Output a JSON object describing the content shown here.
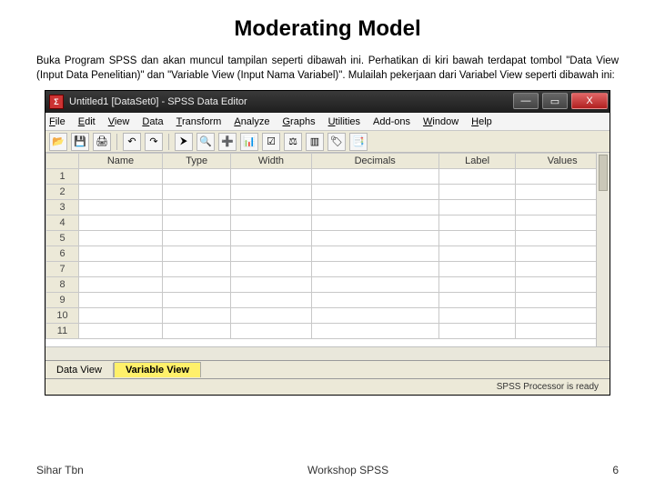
{
  "slide": {
    "title": "Moderating Model",
    "body": "Buka Program SPSS dan akan muncul tampilan seperti dibawah ini. Perhatikan di kiri bawah terdapat tombol \"Data View (Input Data Penelitian)\" dan \"Variable View (Input Nama Variabel)\". Mulailah pekerjaan dari Variabel View seperti dibawah ini:"
  },
  "window": {
    "title": "Untitled1 [DataSet0] - SPSS Data Editor",
    "min": "—",
    "max": "▭",
    "close": "X"
  },
  "menu": {
    "file": "File",
    "edit": "Edit",
    "view": "View",
    "data": "Data",
    "transform": "Transform",
    "analyze": "Analyze",
    "graphs": "Graphs",
    "utilities": "Utilities",
    "addons": "Add-ons",
    "window": "Window",
    "help": "Help"
  },
  "toolbar_icons": {
    "open": "📂",
    "save": "💾",
    "print": "🖨",
    "undo": "↶",
    "redo": "↷",
    "goto": "⮞",
    "find": "🔍",
    "insert": "➕",
    "vars": "📊",
    "select": "☑",
    "weight": "⚖",
    "split": "▥",
    "value": "🏷",
    "sets": "📑"
  },
  "columns": [
    "Name",
    "Type",
    "Width",
    "Decimals",
    "Label",
    "Values"
  ],
  "rows": [
    "1",
    "2",
    "3",
    "4",
    "5",
    "6",
    "7",
    "8",
    "9",
    "10",
    "11"
  ],
  "tabs": {
    "data_view": "Data View",
    "variable_view": "Variable View"
  },
  "status": "SPSS Processor is ready",
  "footer": {
    "left": "Sihar Tbn",
    "center": "Workshop SPSS",
    "right": "6"
  }
}
